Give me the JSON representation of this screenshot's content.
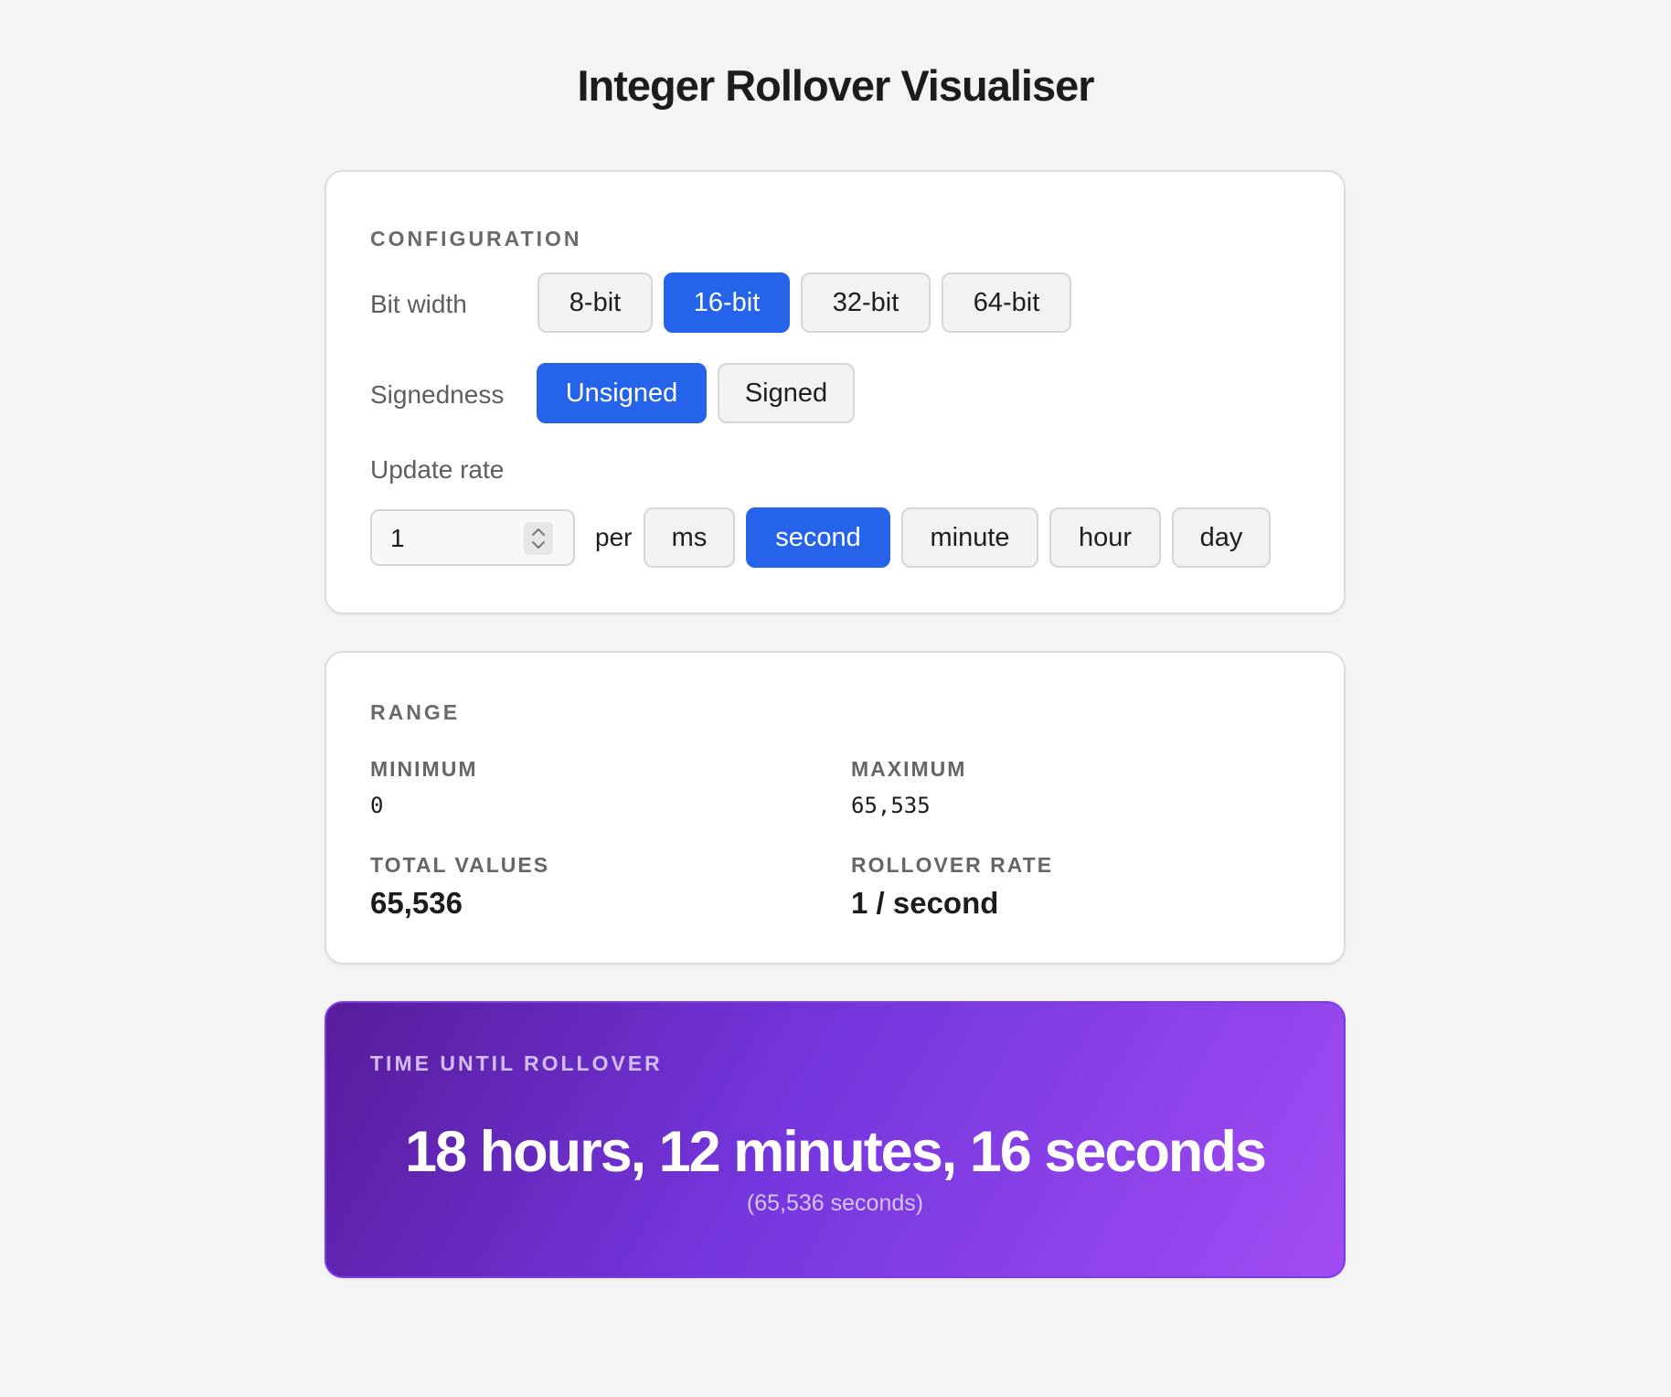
{
  "title": "Integer Rollover Visualiser",
  "configuration": {
    "heading": "CONFIGURATION",
    "bit_width": {
      "label": "Bit width",
      "options": [
        "8-bit",
        "16-bit",
        "32-bit",
        "64-bit"
      ],
      "selected": "16-bit"
    },
    "signedness": {
      "label": "Signedness",
      "options": [
        "Unsigned",
        "Signed"
      ],
      "selected": "Unsigned"
    },
    "update_rate": {
      "label": "Update rate",
      "value": "1",
      "per_label": "per",
      "units": [
        "ms",
        "second",
        "minute",
        "hour",
        "day"
      ],
      "selected": "second"
    }
  },
  "range": {
    "heading": "RANGE",
    "minimum_label": "MINIMUM",
    "minimum": "0",
    "maximum_label": "MAXIMUM",
    "maximum": "65,535",
    "total_label": "TOTAL VALUES",
    "total": "65,536",
    "rate_label": "ROLLOVER RATE",
    "rate": "1 / second"
  },
  "rollover": {
    "heading": "TIME UNTIL ROLLOVER",
    "duration": "18 hours, 12 minutes, 16 seconds",
    "detail": "(65,536 seconds)"
  },
  "colors": {
    "accent": "#2563eb",
    "gradient_start": "#571c9c",
    "gradient_end": "#a14cf2"
  }
}
